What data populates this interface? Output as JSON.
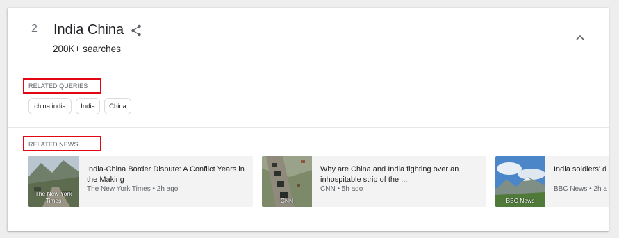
{
  "trend": {
    "rank": "2",
    "title": "India China",
    "searches": "200K+ searches"
  },
  "related_queries": {
    "label": "RELATED QUERIES",
    "chips": [
      "china india",
      "India",
      "China"
    ]
  },
  "related_news": {
    "label": "RELATED NEWS",
    "items": [
      {
        "headline": "India-China Border Dispute: A Conflict Years in the Making",
        "source": "The New York Times",
        "age": "2h ago",
        "meta": "The New York Times • 2h ago",
        "thumb_caption": "The New York Times",
        "thumb_theme": "mountain-road"
      },
      {
        "headline": "Why are China and India fighting over an inhospitable strip of the ...",
        "source": "CNN",
        "age": "5h ago",
        "meta": "CNN • 5h ago",
        "thumb_caption": "CNN",
        "thumb_theme": "convoy"
      },
      {
        "headline": "India soldiers' d Modi",
        "source": "BBC News",
        "age": "2h a",
        "meta": "BBC News • 2h a",
        "thumb_caption": "BBC News",
        "thumb_theme": "sky-mountains"
      }
    ]
  },
  "icons": {
    "share": "share-icon",
    "collapse": "chevron-up-icon"
  },
  "colors": {
    "highlight": "#e30613",
    "card_bg": "#ffffff",
    "page_bg": "#eeeeee",
    "news_bg": "#f3f3f3"
  }
}
